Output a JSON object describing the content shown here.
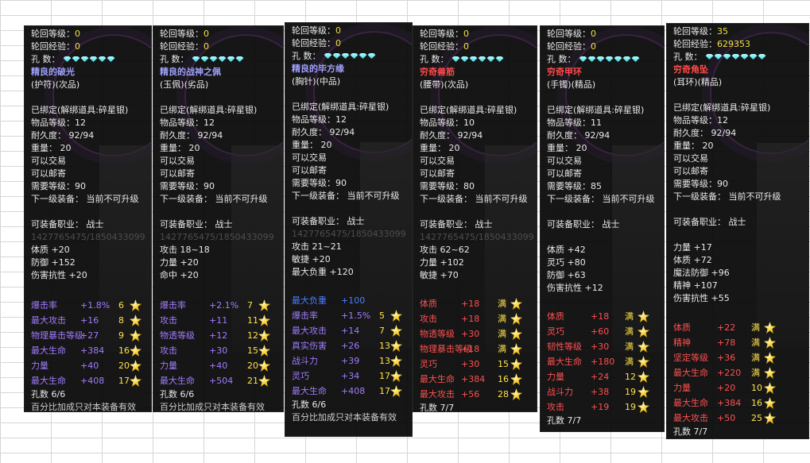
{
  "panels": [
    {
      "name": "精良的破光",
      "name_color": "p",
      "type": "(护符)(次品)",
      "rebirth_level": "0",
      "rebirth_exp": "0",
      "gem_count": 6,
      "bound": "已绑定(解绑道具:碎星银)",
      "item_level": "物品等级：12",
      "durability": "耐久度： 92/94",
      "weight": "重量： 20",
      "tradable": "可以交易",
      "mailable": "可以邮寄",
      "req_level": "需要等级：90",
      "next_equip": "下一级装备：  当前不可升级",
      "job": "可装备职业：  战士",
      "ghost": "1427765475/1850433099",
      "base_stats": [
        "体质 +20",
        "防御 +152",
        "伤害抗性 +20"
      ],
      "special": [
        {
          "label": "爆击率",
          "val": "+1.8%",
          "cnt": "6",
          "color": "s-purple"
        },
        {
          "label": "最大攻击",
          "val": "+16",
          "cnt": "8",
          "color": "s-purple"
        },
        {
          "label": "物理暴击等级",
          "val": "+27",
          "cnt": "9",
          "color": "s-purple"
        },
        {
          "label": "最大生命",
          "val": "+384",
          "cnt": "16",
          "color": "s-purple"
        },
        {
          "label": "力量",
          "val": "+40",
          "cnt": "20",
          "color": "s-purple"
        },
        {
          "label": "最大生命",
          "val": "+408",
          "cnt": "17",
          "color": "s-purple"
        }
      ],
      "holes": "孔数 6/6",
      "footer": "百分比加成只对本装备有效"
    },
    {
      "name": "精良的战神之佩",
      "name_color": "p",
      "type": "(玉佩)(劣品)",
      "rebirth_level": "0",
      "rebirth_exp": "0",
      "gem_count": 6,
      "bound": "已绑定(解绑道具:碎星银)",
      "item_level": "物品等级：12",
      "durability": "耐久度： 92/94",
      "weight": "重量： 20",
      "tradable": "可以交易",
      "mailable": "可以邮寄",
      "req_level": "需要等级：90",
      "next_equip": "下一级装备：  当前不可升级",
      "job": "可装备职业：  战士",
      "ghost": "1427765475/1850433099",
      "base_stats": [
        "攻击 18~18",
        "力量 +20",
        "命中 +20"
      ],
      "special": [
        {
          "label": "爆击率",
          "val": "+2.1%",
          "cnt": "7",
          "color": "s-purple"
        },
        {
          "label": "攻击",
          "val": "+11",
          "cnt": "11",
          "color": "s-purple"
        },
        {
          "label": "物透等级",
          "val": "+12",
          "cnt": "12",
          "color": "s-purple"
        },
        {
          "label": "攻击",
          "val": "+30",
          "cnt": "15",
          "color": "s-purple"
        },
        {
          "label": "力量",
          "val": "+40",
          "cnt": "20",
          "color": "s-purple"
        },
        {
          "label": "最大生命",
          "val": "+504",
          "cnt": "21",
          "color": "s-purple"
        }
      ],
      "holes": "孔数 6/6",
      "footer": "百分比加成只对本装备有效"
    },
    {
      "name": "精良的毕方缘",
      "name_color": "p",
      "type": "(胸针)(中品)",
      "rebirth_level": "0",
      "rebirth_exp": "0",
      "gem_count": 6,
      "bound": "已绑定(解绑道具:碎星银)",
      "item_level": "物品等级：12",
      "durability": "耐久度： 92/94",
      "weight": "重量： 20",
      "tradable": "可以交易",
      "mailable": "可以邮寄",
      "req_level": "需要等级：90",
      "next_equip": "下一级装备：  当前不可升级",
      "job": "可装备职业：  战士",
      "ghost": "1427765475/1850433099",
      "base_stats": [
        "攻击 21~21",
        "敏捷 +20",
        "最大负重 +120"
      ],
      "special": [
        {
          "label": "最大负重",
          "val": "+100",
          "cnt": "",
          "color": "s-blue"
        },
        {
          "label": "爆击率",
          "val": "+1.5%",
          "cnt": "5",
          "color": "s-purple"
        },
        {
          "label": "最大攻击",
          "val": "+14",
          "cnt": "7",
          "color": "s-purple"
        },
        {
          "label": "真实伤害",
          "val": "+26",
          "cnt": "13",
          "color": "s-purple"
        },
        {
          "label": "战斗力",
          "val": "+39",
          "cnt": "13",
          "color": "s-purple"
        },
        {
          "label": "灵巧",
          "val": "+34",
          "cnt": "17",
          "color": "s-purple"
        },
        {
          "label": "最大生命",
          "val": "+408",
          "cnt": "17",
          "color": "s-purple"
        }
      ],
      "holes": "孔数 6/6",
      "footer": "百分比加成只对本装备有效"
    },
    {
      "name": "穷奇兽筋",
      "name_color": "r",
      "type": "(腰带)(次品)",
      "rebirth_level": "0",
      "rebirth_exp": "0",
      "gem_count": 6,
      "bound": "已绑定(解绑道具:碎星银)",
      "item_level": "物品等级：10",
      "durability": "耐久度： 92/94",
      "weight": "重量： 20",
      "tradable": "可以交易",
      "mailable": "可以邮寄",
      "req_level": "需要等级：80",
      "next_equip": "下一级装备：  当前不可升级",
      "job": "可装备职业：  战士",
      "ghost": "1427765475/1850433099",
      "base_stats": [
        "攻击 62~62",
        "力量 +102",
        "敏捷 +70"
      ],
      "special": [
        {
          "label": "体质",
          "val": "+18",
          "cnt": "满",
          "color": "s-red"
        },
        {
          "label": "攻击",
          "val": "+18",
          "cnt": "满",
          "color": "s-red"
        },
        {
          "label": "物透等级",
          "val": "+30",
          "cnt": "满",
          "color": "s-red"
        },
        {
          "label": "物理暴击等级",
          "val": "+18",
          "cnt": "满",
          "color": "s-red"
        },
        {
          "label": "灵巧",
          "val": "+30",
          "cnt": "15",
          "color": "s-red"
        },
        {
          "label": "最大生命",
          "val": "+384",
          "cnt": "16",
          "color": "s-red"
        },
        {
          "label": "最大攻击",
          "val": "+56",
          "cnt": "28",
          "color": "s-red"
        }
      ],
      "holes": "孔数 7/7",
      "footer": ""
    },
    {
      "name": "穷奇甲环",
      "name_color": "r",
      "type": "(手镯)(精品)",
      "rebirth_level": "0",
      "rebirth_exp": "0",
      "gem_count": 7,
      "bound": "已绑定(解绑道具:碎星银)",
      "item_level": "物品等级：11",
      "durability": "耐久度： 92/94",
      "weight": "重量： 20",
      "tradable": "可以交易",
      "mailable": "可以邮寄",
      "req_level": "需要等级：85",
      "next_equip": "下一级装备：  当前不可升级",
      "job": "可装备职业：  战士",
      "ghost": "",
      "base_stats": [
        "体质 +42",
        "灵巧 +80",
        "防御 +63",
        "伤害抗性 +12"
      ],
      "special": [
        {
          "label": "体质",
          "val": "+18",
          "cnt": "满",
          "color": "s-red"
        },
        {
          "label": "灵巧",
          "val": "+60",
          "cnt": "满",
          "color": "s-red"
        },
        {
          "label": "韧性等级",
          "val": "+30",
          "cnt": "满",
          "color": "s-red"
        },
        {
          "label": "最大生命",
          "val": "+180",
          "cnt": "满",
          "color": "s-red"
        },
        {
          "label": "力量",
          "val": "+24",
          "cnt": "12",
          "color": "s-red"
        },
        {
          "label": "战斗力",
          "val": "+38",
          "cnt": "19",
          "color": "s-red"
        },
        {
          "label": "攻击",
          "val": "+19",
          "cnt": "19",
          "color": "s-red"
        }
      ],
      "holes": "孔数 7/7",
      "footer": ""
    },
    {
      "name": "穷奇角坠",
      "name_color": "r",
      "type": "(耳环)(精品)",
      "rebirth_level": "35",
      "rebirth_exp": "629353",
      "gem_count": 7,
      "bound": "已绑定(解绑道具:碎星银)",
      "item_level": "物品等级：12",
      "durability": "耐久度： 92/94",
      "weight": "重量： 20",
      "tradable": "可以交易",
      "mailable": "可以邮寄",
      "req_level": "需要等级：90",
      "next_equip": "下一级装备：  当前不可升级",
      "job": "可装备职业：  战士",
      "ghost": "",
      "base_stats": [
        "力量 +17",
        "体质 +72",
        "魔法防御 +96",
        "精神 +107",
        "伤害抗性 +55"
      ],
      "special": [
        {
          "label": "体质",
          "val": "+22",
          "cnt": "满",
          "color": "s-red"
        },
        {
          "label": "精神",
          "val": "+78",
          "cnt": "满",
          "color": "s-red"
        },
        {
          "label": "坚定等级",
          "val": "+36",
          "cnt": "满",
          "color": "s-red"
        },
        {
          "label": "最大生命",
          "val": "+220",
          "cnt": "满",
          "color": "s-red"
        },
        {
          "label": "力量",
          "val": "+20",
          "cnt": "10",
          "color": "s-red"
        },
        {
          "label": "最大生命",
          "val": "+384",
          "cnt": "16",
          "color": "s-red"
        },
        {
          "label": "最大攻击",
          "val": "+50",
          "cnt": "25",
          "color": "s-red"
        }
      ],
      "holes": "孔数 7/7",
      "footer": ""
    }
  ],
  "labels": {
    "rebirth_level": "轮回等级：",
    "rebirth_exp": "轮回经验：",
    "holes": "孔    数："
  }
}
